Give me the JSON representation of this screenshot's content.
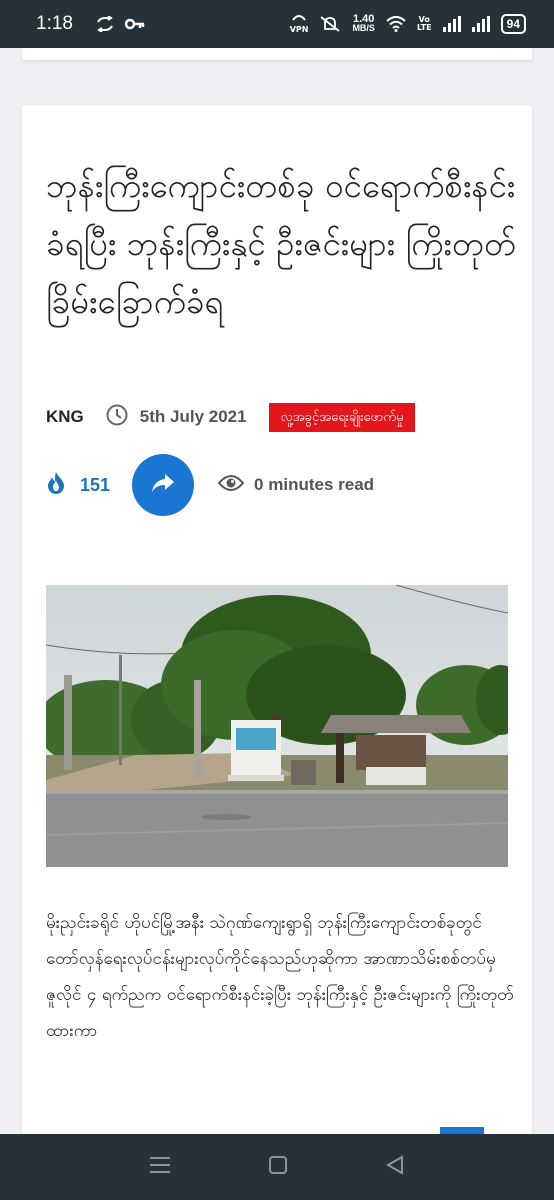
{
  "status_bar": {
    "time": "1:18",
    "network_speed_value": "1.40",
    "network_speed_unit": "MB/S",
    "vpn_label": "VPN",
    "volte_top": "Vo",
    "volte_bottom": "LTE",
    "battery_level": "94"
  },
  "article": {
    "title": "ဘုန်းကြီးကျောင်းတစ်ခု ဝင်ရောက်စီးနင်းခံရပြီး ဘုန်းကြီးနှင့် ဦးဇင်းများ ကြိုးတုတ်ခြိမ်းခြောက်ခံရ",
    "author": "KNG",
    "date": "5th July 2021",
    "category": "လူ့အခွင့်အရေးချိုးဖောက်မှု",
    "views": "151",
    "read_time": "0 minutes read",
    "body": "မိုးညှင်းခရိုင် ဟိုပင်မြို့အနီး သဲဂုဏ်ကျေးရွာရှိ ဘုန်းကြီးကျောင်းတစ်ခုတွင် တော်လှန်ရေးလုပ်ငန်းများလုပ်ကိုင်နေသည်ဟုဆိုကာ အာဏာသိမ်းစစ်တပ်မှ ဇူလိုင် ၄ ရက်ညက ဝင်ရောက်စီးနင်းခဲ့ပြီး ဘုန်းကြီးနှင့် ဦးဇင်းများကို ကြိုးတုတ်ထားကာ"
  },
  "icons": {
    "clock": "clock-icon",
    "fire": "fire-icon",
    "share": "share-icon",
    "eye": "eye-icon",
    "scroll_top": "chevron-up-icon"
  },
  "colors": {
    "accent_blue": "#1976d2",
    "category_red": "#e3161c",
    "status_bar": "#263238"
  }
}
